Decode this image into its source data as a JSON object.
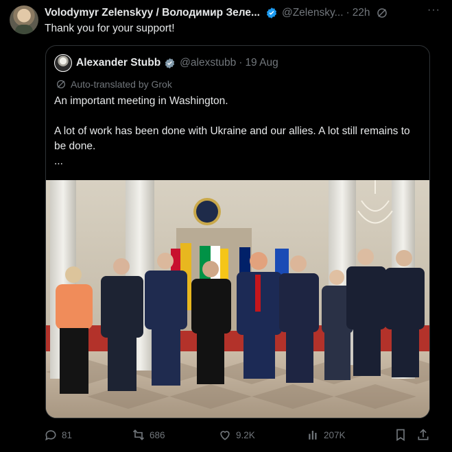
{
  "tweet": {
    "display_name": "Volodymyr Zelenskyy / Володимир Зеле...",
    "handle": "@Zelensky...",
    "separator": "·",
    "time": "22h",
    "more_label": "···",
    "text": "Thank you for your support!"
  },
  "quote": {
    "display_name": "Alexander Stubb",
    "handle": "@alexstubb",
    "separator": "·",
    "date": "19 Aug",
    "translated_label": "Auto-translated by Grok",
    "lines": [
      "An important meeting in Washington.",
      "A lot of work has been done with Ukraine and our allies. A lot still remains to be done.",
      "..."
    ]
  },
  "actions": {
    "replies": "81",
    "reposts": "686",
    "likes": "9.2K",
    "views": "207K"
  },
  "colors": {
    "background": "#000000",
    "text": "#e7e9ea",
    "muted": "#71767b",
    "verified": "#1d9bf0",
    "border": "#2f3336"
  }
}
